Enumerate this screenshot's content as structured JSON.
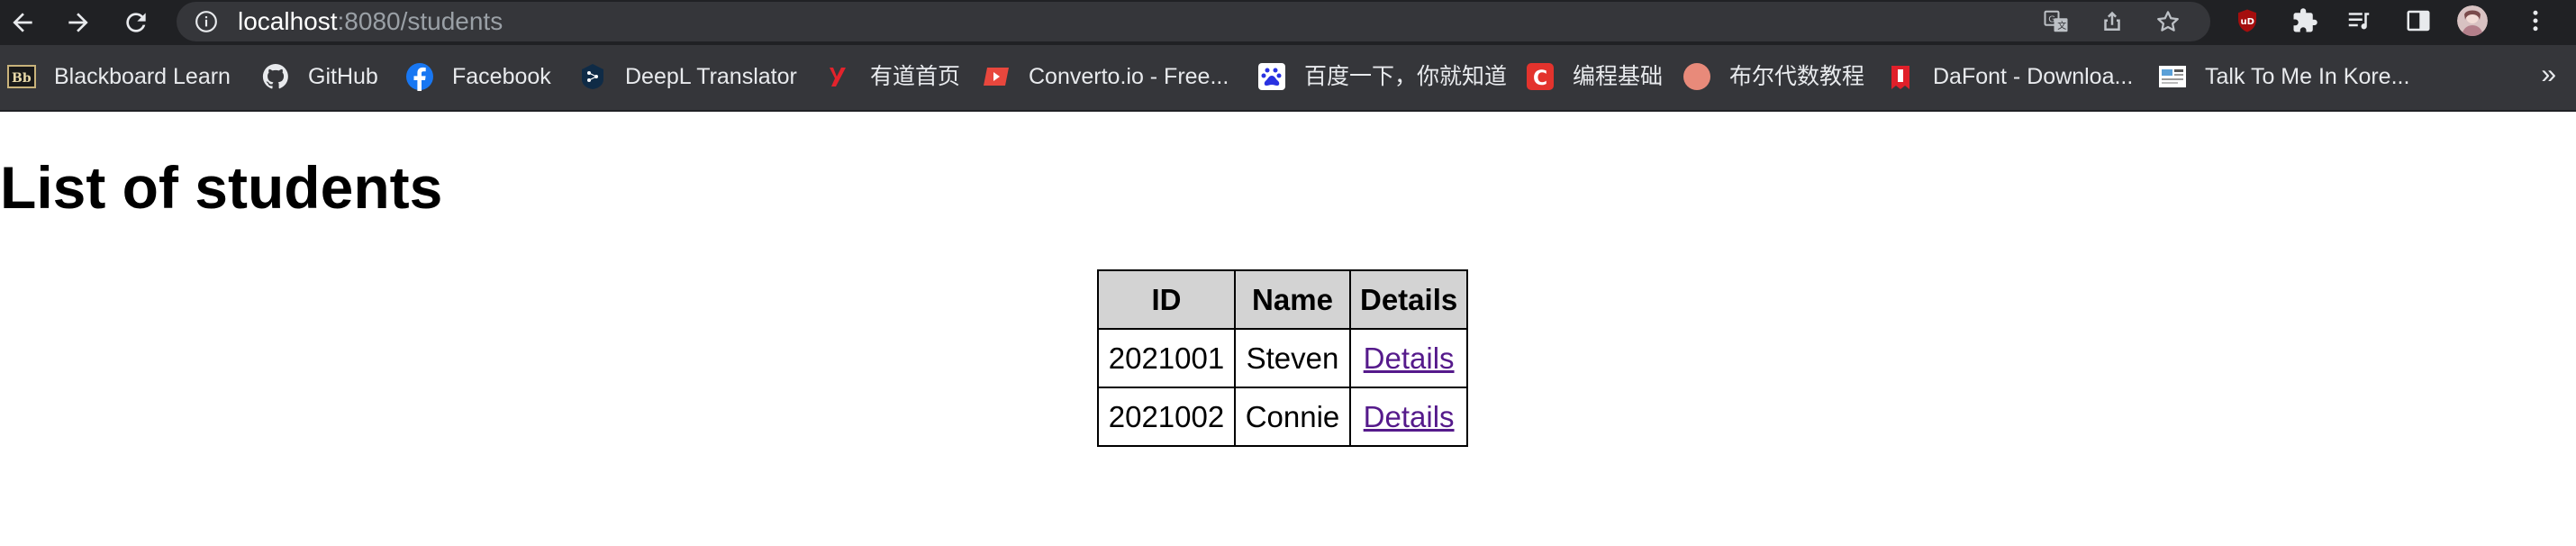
{
  "browser": {
    "url_host": "localhost",
    "url_rest": ":8080/students"
  },
  "bookmarks": [
    {
      "label": "Blackboard Learn",
      "icon": "blackboard-icon"
    },
    {
      "label": "GitHub",
      "icon": "github-icon"
    },
    {
      "label": "Facebook",
      "icon": "facebook-icon"
    },
    {
      "label": "DeepL Translator",
      "icon": "deepl-icon"
    },
    {
      "label": "有道首页",
      "icon": "youdao-icon"
    },
    {
      "label": "Converto.io - Free...",
      "icon": "converto-icon"
    },
    {
      "label": "百度一下，你就知道",
      "icon": "baidu-icon"
    },
    {
      "label": "编程基础",
      "icon": "c-icon"
    },
    {
      "label": "布尔代数教程",
      "icon": "circle-icon"
    },
    {
      "label": "DaFont - Downloa...",
      "icon": "dafont-icon"
    },
    {
      "label": "Talk To Me In Kore...",
      "icon": "ttmik-icon"
    }
  ],
  "bookmarks_more": "»",
  "page": {
    "title": "List of students",
    "table": {
      "headers": [
        "ID",
        "Name",
        "Details"
      ],
      "rows": [
        {
          "id": "2021001",
          "name": "Steven",
          "link": "Details"
        },
        {
          "id": "2021002",
          "name": "Connie",
          "link": "Details"
        }
      ]
    }
  },
  "colors": {
    "toolbar_bg": "#202124",
    "bookmarks_bg": "#35363a",
    "header_cell_bg": "#d3d3d3",
    "link_visited": "#551a8b"
  }
}
